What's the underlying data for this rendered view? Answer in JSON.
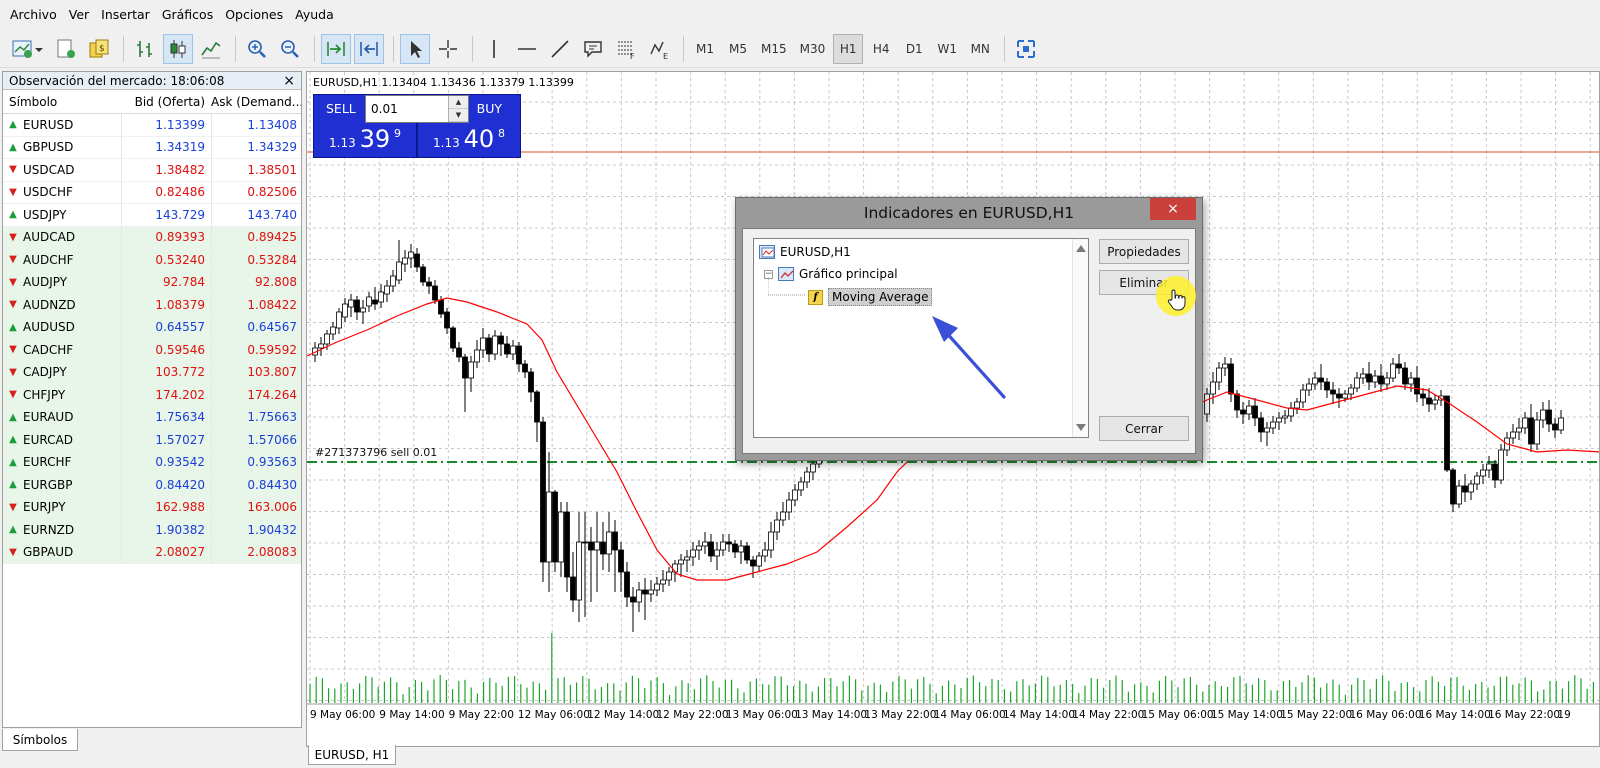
{
  "menu": [
    "Archivo",
    "Ver",
    "Insertar",
    "Gráficos",
    "Opciones",
    "Ayuda"
  ],
  "toolbar": {
    "timeframes": [
      "M1",
      "M5",
      "M15",
      "M30",
      "H1",
      "H4",
      "D1",
      "W1",
      "MN"
    ],
    "active_timeframe": "H1"
  },
  "market_watch": {
    "title": "Observación del mercado: 18:06:08",
    "close_glyph": "×",
    "columns": {
      "symbol": "Símbolo",
      "bid": "Bid (Oferta)",
      "ask": "Ask (Demand..."
    },
    "rows": [
      {
        "symbol": "EURUSD",
        "bid": "1.13399",
        "ask": "1.13408",
        "dir": "up"
      },
      {
        "symbol": "GBPUSD",
        "bid": "1.34319",
        "ask": "1.34329",
        "dir": "up"
      },
      {
        "symbol": "USDCAD",
        "bid": "1.38482",
        "ask": "1.38501",
        "dir": "down"
      },
      {
        "symbol": "USDCHF",
        "bid": "0.82486",
        "ask": "0.82506",
        "dir": "down"
      },
      {
        "symbol": "USDJPY",
        "bid": "143.729",
        "ask": "143.740",
        "dir": "up"
      },
      {
        "symbol": "AUDCAD",
        "bid": "0.89393",
        "ask": "0.89425",
        "dir": "down"
      },
      {
        "symbol": "AUDCHF",
        "bid": "0.53240",
        "ask": "0.53284",
        "dir": "down"
      },
      {
        "symbol": "AUDJPY",
        "bid": "92.784",
        "ask": "92.808",
        "dir": "down"
      },
      {
        "symbol": "AUDNZD",
        "bid": "1.08379",
        "ask": "1.08422",
        "dir": "down"
      },
      {
        "symbol": "AUDUSD",
        "bid": "0.64557",
        "ask": "0.64567",
        "dir": "up"
      },
      {
        "symbol": "CADCHF",
        "bid": "0.59546",
        "ask": "0.59592",
        "dir": "down"
      },
      {
        "symbol": "CADJPY",
        "bid": "103.772",
        "ask": "103.807",
        "dir": "down"
      },
      {
        "symbol": "CHFJPY",
        "bid": "174.202",
        "ask": "174.264",
        "dir": "down"
      },
      {
        "symbol": "EURAUD",
        "bid": "1.75634",
        "ask": "1.75663",
        "dir": "up"
      },
      {
        "symbol": "EURCAD",
        "bid": "1.57027",
        "ask": "1.57066",
        "dir": "up"
      },
      {
        "symbol": "EURCHF",
        "bid": "0.93542",
        "ask": "0.93563",
        "dir": "up"
      },
      {
        "symbol": "EURGBP",
        "bid": "0.84420",
        "ask": "0.84430",
        "dir": "up"
      },
      {
        "symbol": "EURJPY",
        "bid": "162.988",
        "ask": "163.006",
        "dir": "down"
      },
      {
        "symbol": "EURNZD",
        "bid": "1.90382",
        "ask": "1.90432",
        "dir": "up"
      },
      {
        "symbol": "GBPAUD",
        "bid": "2.08027",
        "ask": "2.08083",
        "dir": "down"
      }
    ],
    "tab_label": "Símbolos"
  },
  "chart": {
    "info": "EURUSD,H1  1.13404 1.13436 1.13379 1.13399",
    "tab_label": "EURUSD, H1",
    "order_label": "#271373796 sell 0.01",
    "x_labels": [
      "9 May 06:00",
      "9 May 14:00",
      "9 May 22:00",
      "12 May 06:00",
      "12 May 14:00",
      "12 May 22:00",
      "13 May 06:00",
      "13 May 14:00",
      "13 May 22:00",
      "14 May 06:00",
      "14 May 14:00",
      "14 May 22:00",
      "15 May 06:00",
      "15 May 14:00",
      "15 May 22:00",
      "16 May 06:00",
      "16 May 14:00",
      "16 May 22:00",
      "19"
    ]
  },
  "trade": {
    "sell_label": "SELL",
    "buy_label": "BUY",
    "lot": "0.01",
    "sell_price_prefix": "1.13",
    "sell_price_big": "39",
    "sell_price_sup": "9",
    "buy_price_prefix": "1.13",
    "buy_price_big": "40",
    "buy_price_sup": "8"
  },
  "dialog": {
    "title": "Indicadores en EURUSD,H1",
    "close_glyph": "×",
    "tree": {
      "root": "EURUSD,H1",
      "main": "Gráfico principal",
      "indicator": "Moving Average"
    },
    "buttons": {
      "properties": "Propiedades",
      "delete": "Eliminar",
      "close": "Cerrar"
    }
  },
  "colors": {
    "up_value": "#1a3fd6",
    "down_value": "#e01010",
    "trade_panel": "#1f2fd1",
    "moving_average": "#ff0000",
    "order_line": "#1a8a2e",
    "volume": "#1aa62a",
    "dialog_close": "#c9403a",
    "annotation_arrow": "#3a50d6"
  }
}
